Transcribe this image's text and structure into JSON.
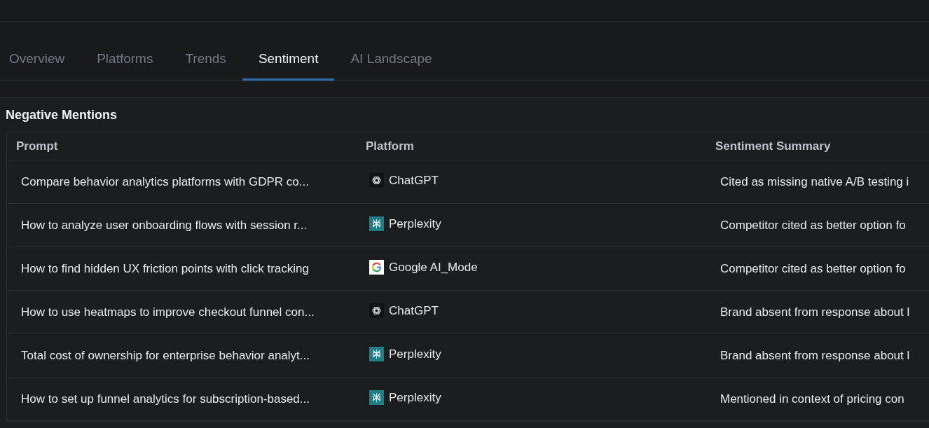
{
  "tabs": [
    {
      "label": "Overview",
      "selected": false
    },
    {
      "label": "Platforms",
      "selected": false
    },
    {
      "label": "Trends",
      "selected": false
    },
    {
      "label": "Sentiment",
      "selected": true
    },
    {
      "label": "AI Landscape",
      "selected": false
    }
  ],
  "negative_mentions": {
    "title": "Negative Mentions",
    "table": {
      "columns": [
        "Prompt",
        "Platform",
        "Sentiment Summary"
      ],
      "rows": [
        {
          "prompt": "Compare behavior analytics platforms with GDPR co...",
          "platform": {
            "name": "ChatGPT",
            "kind": "chatgpt"
          },
          "summary": "Cited as missing native A/B testing i"
        },
        {
          "prompt": "How to analyze user onboarding flows with session r...",
          "platform": {
            "name": "Perplexity",
            "kind": "perplexity"
          },
          "summary": "Competitor cited as better option fo"
        },
        {
          "prompt": "How to find hidden UX friction points with click tracking",
          "platform": {
            "name": "Google AI_Mode",
            "kind": "google"
          },
          "summary": "Competitor cited as better option fo"
        },
        {
          "prompt": "How to use heatmaps to improve checkout funnel con...",
          "platform": {
            "name": "ChatGPT",
            "kind": "chatgpt"
          },
          "summary": "Brand absent from response about l"
        },
        {
          "prompt": "Total cost of ownership for enterprise behavior analyt...",
          "platform": {
            "name": "Perplexity",
            "kind": "perplexity"
          },
          "summary": "Brand absent from response about l"
        },
        {
          "prompt": "How to set up funnel analytics for subscription-based...",
          "platform": {
            "name": "Perplexity",
            "kind": "perplexity"
          },
          "summary": "Mentioned in context of pricing con"
        }
      ]
    }
  }
}
